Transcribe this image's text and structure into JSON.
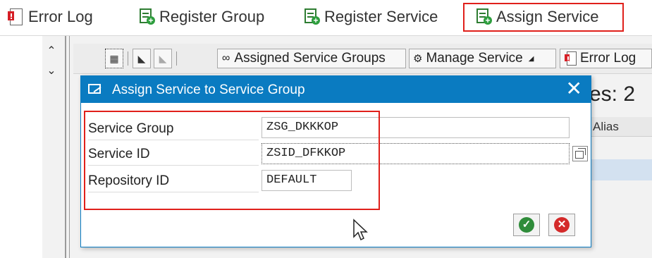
{
  "top_toolbar": {
    "error_log": "Error Log",
    "register_group": "Register Group",
    "register_service": "Register Service",
    "assign_service": "Assign Service"
  },
  "inner_toolbar": {
    "assigned_service_groups": "Assigned Service Groups",
    "manage_service": "Manage Service",
    "error_log": "Error Log"
  },
  "background": {
    "title_fragment": "es: 2",
    "column_header": "Alias"
  },
  "dialog": {
    "title": "Assign Service to Service Group",
    "fields": {
      "service_group": {
        "label": "Service Group",
        "value": "ZSG_DKKKOP"
      },
      "service_id": {
        "label": "Service ID",
        "value": "ZSID_DFKKOP"
      },
      "repository_id": {
        "label": "Repository ID",
        "value": "DEFAULT"
      }
    }
  },
  "colors": {
    "accent_blue": "#0a7bc1",
    "highlight_red": "#e0201b",
    "confirm_green": "#2f8c3a",
    "cancel_red": "#d42a2a"
  },
  "icons": {
    "error_log": "error-log-icon",
    "register": "register-doc-plus-icon",
    "close": "close-icon",
    "confirm": "check-icon",
    "cancel": "cancel-x-icon"
  }
}
